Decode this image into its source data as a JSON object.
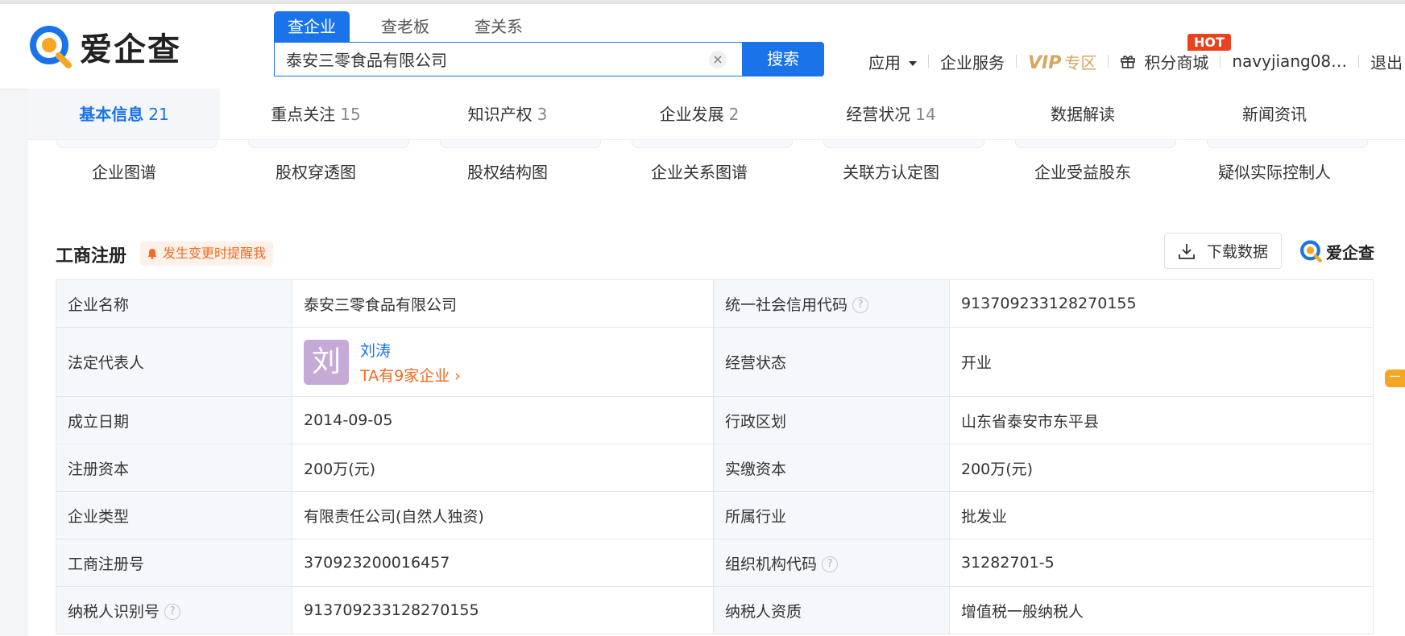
{
  "header": {
    "logo_text": "爱企查",
    "search_tabs": [
      {
        "label": "查企业",
        "active": true
      },
      {
        "label": "查老板",
        "active": false
      },
      {
        "label": "查关系",
        "active": false
      }
    ],
    "search_value": "泰安三零食品有限公司",
    "clear_symbol": "×",
    "search_button": "搜索",
    "nav": {
      "apps": "应用",
      "services": "企业服务",
      "vip": "VIP",
      "vip_zone": "专区",
      "points_mall": "积分商城",
      "hot_badge": "HOT",
      "user": "navyjiang08…",
      "logout": "退出"
    }
  },
  "content_tabs": [
    {
      "label": "基本信息",
      "count": "21",
      "active": true
    },
    {
      "label": "重点关注",
      "count": "15"
    },
    {
      "label": "知识产权",
      "count": "3"
    },
    {
      "label": "企业发展",
      "count": "2"
    },
    {
      "label": "经营状况",
      "count": "14"
    },
    {
      "label": "数据解读",
      "count": ""
    },
    {
      "label": "新闻资讯",
      "count": ""
    }
  ],
  "shortcuts": [
    "企业图谱",
    "股权穿透图",
    "股权结构图",
    "企业关系图谱",
    "关联方认定图",
    "企业受益股东",
    "疑似实际控制人"
  ],
  "section": {
    "title": "工商注册",
    "remind": "发生变更时提醒我",
    "download": "下载数据",
    "watermark": "爱企查"
  },
  "info": {
    "name_label": "企业名称",
    "name_value": "泰安三零食品有限公司",
    "credit_label": "统一社会信用代码",
    "credit_value": "913709233128270155",
    "legal_label": "法定代表人",
    "legal_avatar": "刘",
    "legal_name": "刘涛",
    "legal_count": "TA有9家企业",
    "status_label": "经营状态",
    "status_value": "开业",
    "founded_label": "成立日期",
    "founded_value": "2014-09-05",
    "region_label": "行政区划",
    "region_value": "山东省泰安市东平县",
    "capital_label": "注册资本",
    "capital_value": "200万(元)",
    "paid_label": "实缴资本",
    "paid_value": "200万(元)",
    "type_label": "企业类型",
    "type_value": "有限责任公司(自然人独资)",
    "industry_label": "所属行业",
    "industry_value": "批发业",
    "regno_label": "工商注册号",
    "regno_value": "370923200016457",
    "orgcode_label": "组织机构代码",
    "orgcode_value": "31282701-5",
    "taxid_label": "纳税人识别号",
    "taxid_value": "913709233128270155",
    "taxqual_label": "纳税人资质",
    "taxqual_value": "增值税一般纳税人"
  },
  "side_tab": "一",
  "colors": {
    "accent": "#1a73e8",
    "orange": "#f26a21",
    "vip_gold": "#d6a561",
    "hot_red": "#e8421f"
  }
}
